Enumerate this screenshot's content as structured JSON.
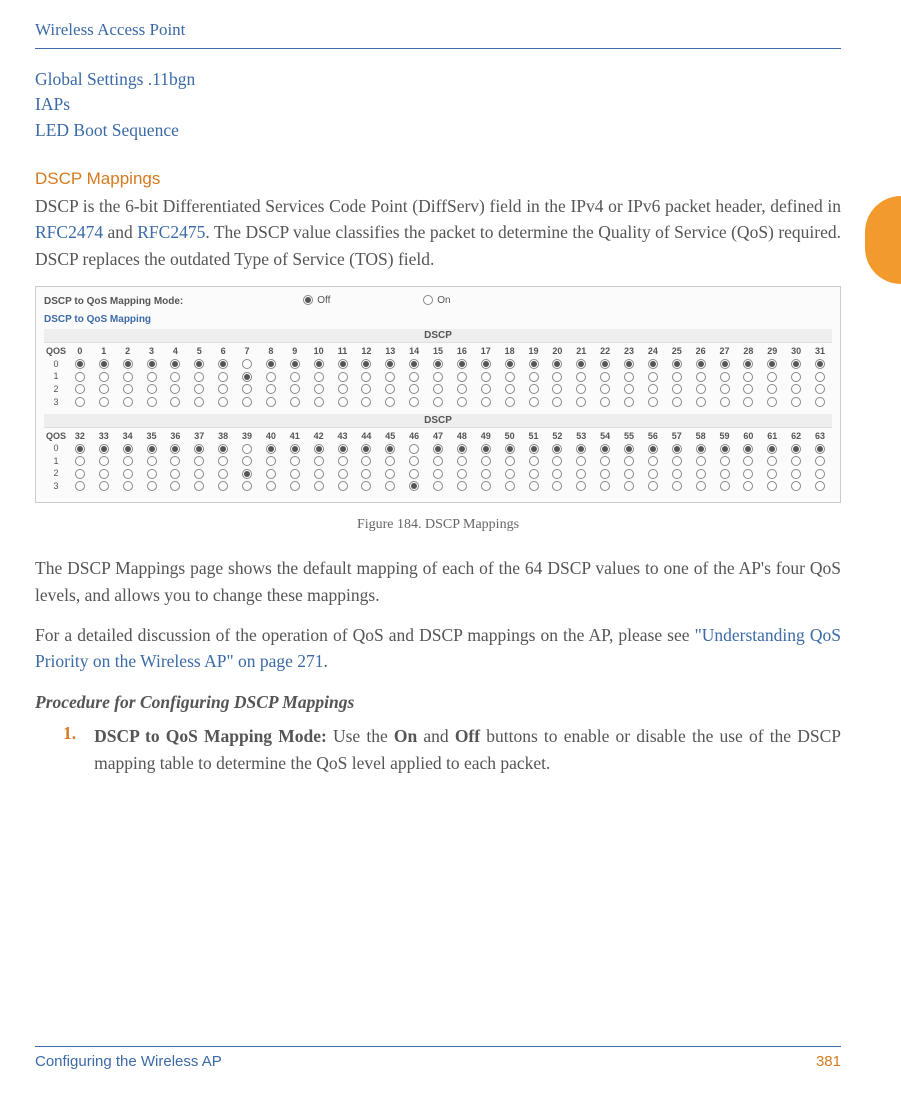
{
  "header": {
    "title": "Wireless Access Point"
  },
  "links": {
    "global": "Global Settings .11bgn",
    "iaps": "IAPs",
    "led": "LED Boot Sequence"
  },
  "section": {
    "title": "DSCP Mappings"
  },
  "intro": {
    "p1a": "DSCP is the 6-bit Differentiated Services Code Point (DiffServ) field in the IPv4 or IPv6 packet header, defined in ",
    "rfc1": "RFC2474",
    "p1b": " and ",
    "rfc2": "RFC2475",
    "p1c": ". The DSCP value classifies the packet to determine the Quality of Service (QoS) required. DSCP replaces the outdated Type of Service (TOS) field."
  },
  "shot": {
    "modeLabel": "DSCP to QoS Mapping Mode:",
    "off": "Off",
    "on": "On",
    "sub": "DSCP to QoS Mapping",
    "dscp": "DSCP",
    "qos": "QOS",
    "cols1": [
      "0",
      "1",
      "2",
      "3",
      "4",
      "5",
      "6",
      "7",
      "8",
      "9",
      "10",
      "11",
      "12",
      "13",
      "14",
      "15",
      "16",
      "17",
      "18",
      "19",
      "20",
      "21",
      "22",
      "23",
      "24",
      "25",
      "26",
      "27",
      "28",
      "29",
      "30",
      "31"
    ],
    "cols2": [
      "32",
      "33",
      "34",
      "35",
      "36",
      "37",
      "38",
      "39",
      "40",
      "41",
      "42",
      "43",
      "44",
      "45",
      "46",
      "47",
      "48",
      "49",
      "50",
      "51",
      "52",
      "53",
      "54",
      "55",
      "56",
      "57",
      "58",
      "59",
      "60",
      "61",
      "62",
      "63"
    ],
    "qosRows": [
      "0",
      "1",
      "2",
      "3"
    ],
    "sel1": {
      "0": [
        0,
        1,
        2,
        3,
        4,
        5,
        6,
        8,
        9,
        10,
        11,
        12,
        13,
        14,
        15,
        16,
        17,
        18,
        19,
        20,
        21,
        22,
        23,
        24,
        25,
        26,
        27,
        28,
        29,
        30,
        31
      ],
      "1": [
        7
      ]
    },
    "sel2": {
      "0": [
        32,
        33,
        34,
        35,
        36,
        37,
        38,
        40,
        41,
        42,
        43,
        44,
        45,
        47,
        48,
        49,
        50,
        51,
        52,
        53,
        54,
        55,
        56,
        57,
        58,
        59,
        60,
        61,
        62,
        63
      ],
      "2": [
        39
      ],
      "3": [
        46
      ]
    }
  },
  "figcap": "Figure 184. DSCP Mappings",
  "para2": "The DSCP Mappings page shows the default mapping of each of the 64 DSCP values to one of the AP's four QoS levels, and allows you to change these mappings.",
  "para3a": "For a detailed discussion of the operation of QoS and DSCP mappings on the AP, please see ",
  "para3link": "\"Understanding QoS Priority on the Wireless AP\" on page 271",
  "para3b": ".",
  "procTitle": "Procedure for Configuring DSCP Mappings",
  "step1": {
    "num": "1.",
    "bold1": "DSCP to QoS Mapping Mode: ",
    "t1": "Use the ",
    "bold2": "On",
    "t2": " and ",
    "bold3": "Off",
    "t3": " buttons to enable or disable the use of the DSCP mapping table to determine the QoS level applied to each packet."
  },
  "footer": {
    "left": "Configuring the Wireless AP",
    "page": "381"
  }
}
